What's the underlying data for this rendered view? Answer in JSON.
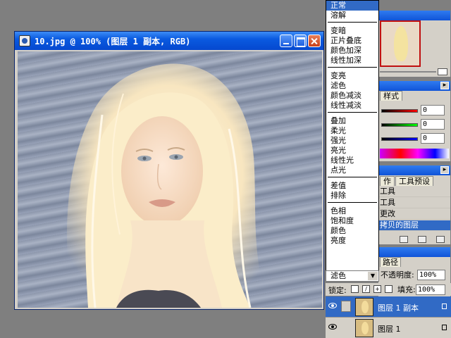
{
  "document": {
    "title": "10.jpg @ 100% (图层 1 副本, RGB)",
    "min_label": "",
    "max_label": "",
    "close_label": ""
  },
  "blend_modes": {
    "items": [
      "正常",
      "溶解",
      "变暗",
      "正片叠底",
      "颜色加深",
      "线性加深",
      "变亮",
      "滤色",
      "颜色减淡",
      "线性减淡",
      "叠加",
      "柔光",
      "强光",
      "亮光",
      "线性光",
      "点光",
      "差值",
      "排除",
      "色相",
      "饱和度",
      "颜色",
      "亮度"
    ],
    "selected": "正常",
    "current": "滤色"
  },
  "color_panel": {
    "tab": "样式",
    "r": "0",
    "g": "0",
    "b": "0"
  },
  "history_panel": {
    "tabs": [
      "作",
      "工具预设"
    ],
    "items": [
      "工具",
      "工具",
      "更改",
      "拷贝的图层"
    ]
  },
  "layers_panel": {
    "tab": "路径",
    "opacity_label": "不透明度:",
    "opacity": "100%",
    "lock_label": "锁定:",
    "fill_label": "填充:",
    "fill": "100%",
    "layers": [
      {
        "name": "图层 1 副本",
        "selected": true
      },
      {
        "name": "图层 1",
        "selected": false
      }
    ]
  },
  "colors": {
    "titlebar": "#0548cf",
    "selection": "#316ac5"
  }
}
